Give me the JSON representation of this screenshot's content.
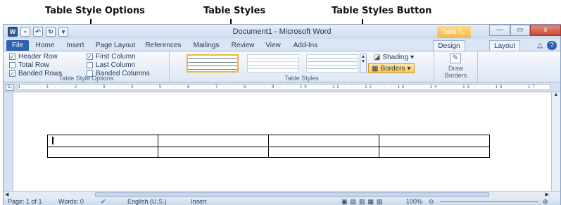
{
  "annotations": {
    "table_style_options": "Table Style Options",
    "table_styles": "Table Styles",
    "table_styles_button": "Table Styles Button"
  },
  "window": {
    "title": "Document1 - Microsoft Word",
    "contextual_tab": "Table T...",
    "word_logo": "W",
    "minimize": "—",
    "maximize": "▭",
    "close": "x",
    "help": "?",
    "collapse": "△"
  },
  "tabs": [
    "File",
    "Home",
    "Insert",
    "Page Layout",
    "References",
    "Mailings",
    "Review",
    "View",
    "Add-Ins",
    "Design",
    "Layout"
  ],
  "ribbon": {
    "style_options": {
      "label": "Table Style Options",
      "items": [
        {
          "label": "Header Row",
          "checked": true
        },
        {
          "label": "Total Row",
          "checked": false
        },
        {
          "label": "Banded Rows",
          "checked": true
        },
        {
          "label": "First Column",
          "checked": true
        },
        {
          "label": "Last Column",
          "checked": false
        },
        {
          "label": "Banded Columns",
          "checked": false
        }
      ]
    },
    "table_styles": {
      "label": "Table Styles",
      "shading": "Shading",
      "borders": "Borders"
    },
    "draw_borders": {
      "line1": "Draw",
      "line2": "Borders"
    }
  },
  "ruler_marks": "1 · · · 1 · · · 2 · · · 3 · · · 4 · · · 5 · · · 6 · · · 7 · · · 8 · · · 9 · · · 10 · · · 11 · · · 12 · · · 13 · · · 14 · · · 15 · · · 16 · · · 17",
  "document": {
    "table": {
      "rows": 2,
      "cols": 4
    }
  },
  "statusbar": {
    "page": "Page: 1 of 1",
    "words": "Words: 0",
    "language": "English (U.S.)",
    "mode": "Insert",
    "zoom": "100%"
  }
}
